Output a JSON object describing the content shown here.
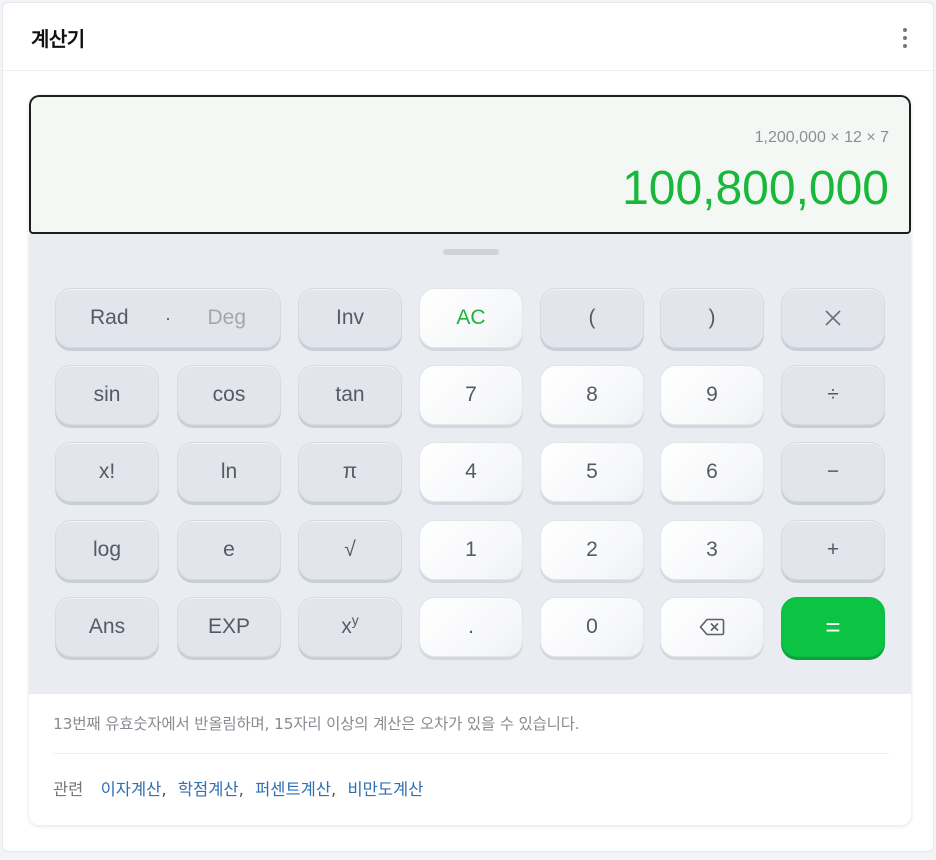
{
  "header": {
    "title": "계산기",
    "more_icon": "more-vertical-icon"
  },
  "display": {
    "expression": "1,200,000 × 12 × 7",
    "result": "100,800,000",
    "result_color": "#18b83a"
  },
  "keys": {
    "rad": "Rad",
    "dot_sep": "·",
    "deg": "Deg",
    "inv": "Inv",
    "ac": "AC",
    "lparen": "(",
    "rparen": ")",
    "multiply": "×",
    "sin": "sin",
    "cos": "cos",
    "tan": "tan",
    "n7": "7",
    "n8": "8",
    "n9": "9",
    "divide": "÷",
    "fact": "x!",
    "ln": "ln",
    "pi": "π",
    "n4": "4",
    "n5": "5",
    "n6": "6",
    "minus": "−",
    "log": "log",
    "e": "e",
    "sqrt": "√",
    "n1": "1",
    "n2": "2",
    "n3": "3",
    "plus": "+",
    "ans": "Ans",
    "exp": "EXP",
    "pow_base": "x",
    "pow_exp": "y",
    "decimal": ".",
    "n0": "0",
    "backspace_icon": "backspace-icon",
    "equals": "="
  },
  "note": "13번째 유효숫자에서 반올림하며, 15자리 이상의 계산은 오차가 있을 수 있습니다.",
  "related": {
    "label": "관련",
    "links": [
      "이자계산",
      "학점계산",
      "퍼센트계산",
      "비만도계산"
    ],
    "separator": ","
  },
  "colors": {
    "accent_green": "#0cc444",
    "link_blue": "#2f6fb3"
  }
}
